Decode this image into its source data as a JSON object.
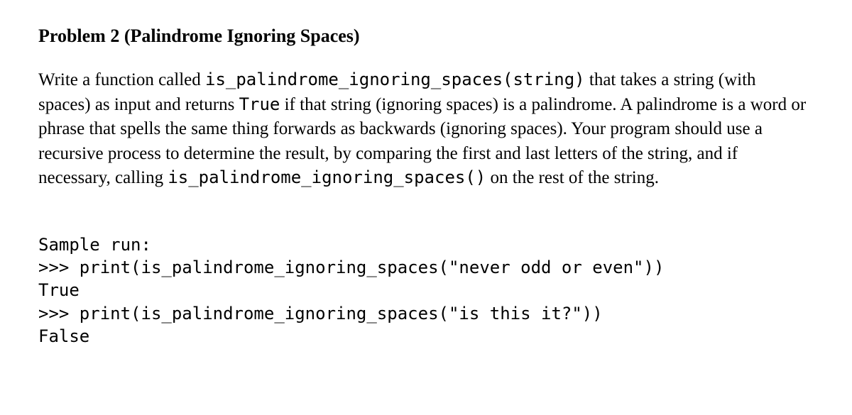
{
  "heading": "Problem 2 (Palindrome Ignoring Spaces)",
  "desc": {
    "p1": "Write a function called ",
    "c1": "is_palindrome_ignoring_spaces(string)",
    "p2": " that takes a string (with spaces) as input and returns ",
    "c2": "True",
    "p3": " if that string (ignoring spaces) is a palindrome. A palindrome is a word or phrase that spells the same thing forwards as backwards (ignoring spaces). Your program should use a recursive process to determine the result, by comparing the first and last letters of the string, and if necessary, calling ",
    "c3": "is_palindrome_ignoring_spaces()",
    "p4": " on the rest of the string."
  },
  "sample": {
    "l1": "Sample run:",
    "l2": ">>> print(is_palindrome_ignoring_spaces(\"never odd or even\"))",
    "l3": "True",
    "l4": ">>> print(is_palindrome_ignoring_spaces(\"is this it?\"))",
    "l5": "False"
  }
}
